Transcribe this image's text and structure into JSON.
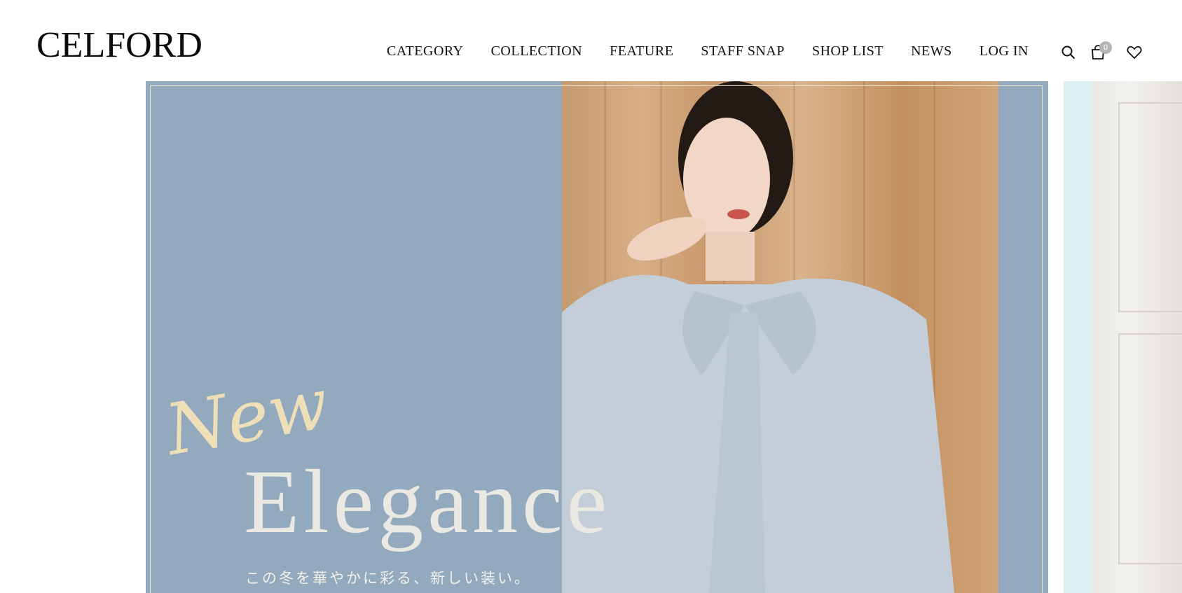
{
  "header": {
    "logo": "CELFORD",
    "nav": [
      {
        "label": "CATEGORY"
      },
      {
        "label": "COLLECTION"
      },
      {
        "label": "FEATURE"
      },
      {
        "label": "STAFF SNAP"
      },
      {
        "label": "SHOP LIST"
      },
      {
        "label": "NEWS"
      },
      {
        "label": "LOG IN"
      }
    ],
    "icons": {
      "search": "search-icon",
      "cart": "shopping-bag-icon",
      "favorites": "heart-icon"
    },
    "cart_count": "0"
  },
  "hero": {
    "slide_main": {
      "script_word": "New",
      "headline": "Elegance",
      "subtitle": "この冬を華やかに彩る、新しい装い。"
    }
  },
  "colors": {
    "hero_blue": "#93a9bd",
    "script_gold": "#efdfb8",
    "next_slide_mint": "#def0f1",
    "badge_gray": "#b5b5b5"
  }
}
